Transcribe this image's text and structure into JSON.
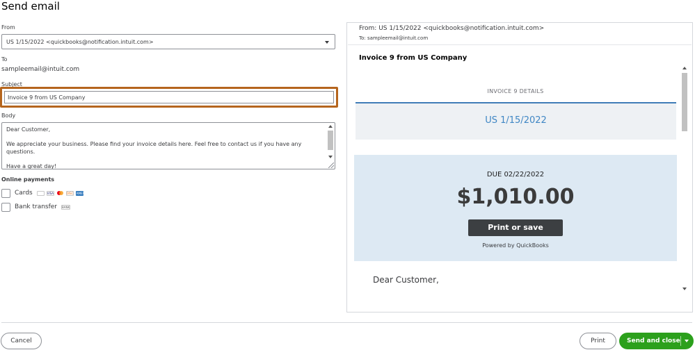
{
  "dialog": {
    "title": "Send email"
  },
  "form": {
    "from_label": "From",
    "from_value": "US 1/15/2022 <quickbooks@notification.intuit.com>",
    "to_label": "To",
    "to_value": "sampleemail@intuit.com",
    "subject_label": "Subject",
    "subject_value": "Invoice 9 from US Company",
    "body_label": "Body",
    "body_lines": [
      "Dear Customer,",
      "We appreciate your business. Please find your invoice details here. Feel free to contact us if you have any questions.",
      "Have a great day!"
    ],
    "online_payments_label": "Online payments",
    "cards_label": "Cards",
    "card_icons": [
      "applepay",
      "VISA",
      "mastercard",
      "DISC",
      "AMEX"
    ],
    "bank_label": "Bank transfer",
    "bank_icon": "BANK"
  },
  "preview": {
    "from": "From: US 1/15/2022 <quickbooks@notification.intuit.com>",
    "to": "To: sampleemail@intuit.com",
    "subject": "Invoice 9 from US Company",
    "details_heading": "INVOICE 9 DETAILS",
    "date": "US 1/15/2022",
    "due": "DUE 02/22/2022",
    "amount": "$1,010.00",
    "print_save": "Print or save",
    "powered_by": "Powered by QuickBooks",
    "greeting": "Dear Customer,"
  },
  "footer": {
    "cancel": "Cancel",
    "print": "Print",
    "send_close": "Send and close"
  },
  "colors": {
    "accent_green": "#2ca01c",
    "focus_border": "#b5651d",
    "invoice_blue": "#3f86c4"
  }
}
